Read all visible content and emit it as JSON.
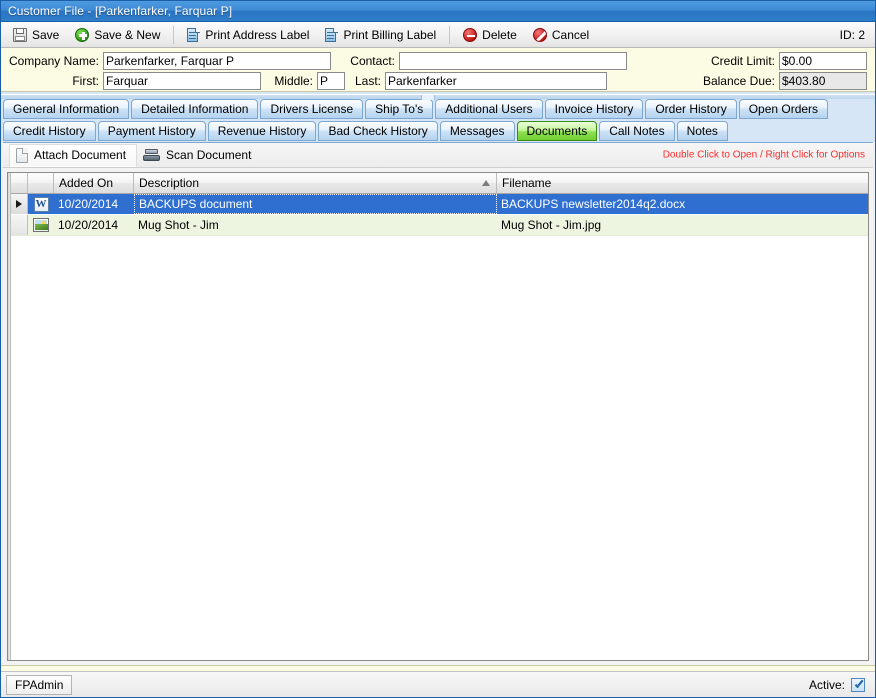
{
  "window": {
    "title": "Customer File - [Parkenfarker, Farquar P]"
  },
  "toolbar": {
    "save_label": "Save",
    "save_new_label": "Save & New",
    "print_address_label": "Print Address Label",
    "print_billing_label": "Print Billing Label",
    "delete_label": "Delete",
    "cancel_label": "Cancel",
    "record_id": "ID: 2",
    "icons": {
      "save": "floppy-disk-icon",
      "save_new": "green-plus-circle-icon",
      "print_address": "print-label-icon",
      "print_billing": "print-label-icon",
      "delete": "red-minus-circle-icon",
      "cancel": "red-slash-circle-icon"
    }
  },
  "form": {
    "company_name_label": "Company Name:",
    "company_name_value": "Parkenfarker, Farquar P",
    "contact_label": "Contact:",
    "contact_value": "",
    "contact_placeholder": "",
    "first_label": "First:",
    "first_value": "Farquar",
    "middle_label": "Middle:",
    "middle_value": "P",
    "last_label": "Last:",
    "last_value": "Parkenfarker",
    "credit_limit_label": "Credit Limit:",
    "credit_limit_value": "$0.00",
    "balance_due_label": "Balance Due:",
    "balance_due_value": "$403.80"
  },
  "tabs": {
    "row1": [
      {
        "label": "General Information",
        "active": false
      },
      {
        "label": "Detailed Information",
        "active": false
      },
      {
        "label": "Drivers License",
        "active": false
      },
      {
        "label": "Ship To's",
        "active": false
      },
      {
        "label": "Additional Users",
        "active": false
      },
      {
        "label": "Invoice History",
        "active": false
      },
      {
        "label": "Order History",
        "active": false
      },
      {
        "label": "Open Orders",
        "active": false
      }
    ],
    "row2": [
      {
        "label": "Credit History",
        "active": false
      },
      {
        "label": "Payment History",
        "active": false
      },
      {
        "label": "Revenue History",
        "active": false
      },
      {
        "label": "Bad Check History",
        "active": false
      },
      {
        "label": "Messages",
        "active": false
      },
      {
        "label": "Documents",
        "active": true
      },
      {
        "label": "Call Notes",
        "active": false
      },
      {
        "label": "Notes",
        "active": false
      }
    ],
    "active_tab": "Documents",
    "active_color": "#6ed02f"
  },
  "documents_tab": {
    "attach_label": "Attach Document",
    "scan_label": "Scan Document",
    "attach_icon": "document-icon",
    "scan_icon": "scanner-icon",
    "hint_text": "Double Click to Open / Right Click for Options",
    "hint_color": "#ff2d2d",
    "grid": {
      "columns": [
        "",
        "",
        "Added On",
        "Description",
        "Filename"
      ],
      "sorted_column": "Description",
      "sort_direction": "ascending",
      "rows": [
        {
          "icon": "word-document-icon",
          "added_on": "10/20/2014",
          "description": "BACKUPS document",
          "filename": "BACKUPS newsletter2014q2.docx",
          "selected": true
        },
        {
          "icon": "image-file-icon",
          "added_on": "10/20/2014",
          "description": "Mug Shot - Jim",
          "filename": "Mug Shot - Jim.jpg",
          "selected": false
        }
      ],
      "selection_color": "#2e6fd0",
      "alt_row_color": "#edf5e1"
    }
  },
  "statusbar": {
    "user": "FPAdmin",
    "active_label": "Active:",
    "active_checked": true
  }
}
